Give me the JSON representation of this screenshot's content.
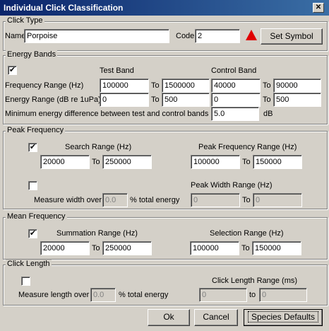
{
  "window": {
    "title": "Individual Click Classification",
    "close_label": "✕"
  },
  "click_type": {
    "legend": "Click Type",
    "name_label": "Name",
    "name_value": "Porpoise",
    "code_label": "Code",
    "code_value": "2",
    "symbol_icon": "red-triangle-icon",
    "symbol_color": "#e00000",
    "set_symbol_label": "Set Symbol"
  },
  "energy_bands": {
    "legend": "Energy Bands",
    "checked": true,
    "check_mark": "✔",
    "test_band_label": "Test Band",
    "control_band_label": "Control Band",
    "freq_label": "Frequency Range (Hz)",
    "freq_test_min": "100000",
    "freq_test_max": "1500000",
    "freq_ctrl_min": "40000",
    "freq_ctrl_max": "90000",
    "energy_label": "Energy Range (dB re 1uPa)",
    "energy_test_min": "0",
    "energy_test_max": "500",
    "energy_ctrl_min": "0",
    "energy_ctrl_max": "500",
    "to_label": "To",
    "min_diff_label": "Minimum energy difference between test and control bands",
    "min_diff_value": "5.0",
    "db_label": "dB"
  },
  "peak_frequency": {
    "legend": "Peak Frequency",
    "search_checked": true,
    "check_mark": "✔",
    "search_label": "Search Range (Hz)",
    "search_min": "20000",
    "search_max": "250000",
    "peak_range_label": "Peak Frequency Range (Hz)",
    "peak_min": "100000",
    "peak_max": "150000",
    "to_label": "To",
    "width_checked": false,
    "measure_width_label": "Measure width over",
    "width_pct": "0.0",
    "pct_total_label": "% total energy",
    "peak_width_label": "Peak Width Range (Hz)",
    "width_min": "0",
    "width_max": "0"
  },
  "mean_frequency": {
    "legend": "Mean Frequency",
    "checked": true,
    "check_mark": "✔",
    "summation_label": "Summation Range (Hz)",
    "sum_min": "20000",
    "sum_max": "250000",
    "selection_label": "Selection Range (Hz)",
    "sel_min": "100000",
    "sel_max": "150000",
    "to_label": "To"
  },
  "click_length": {
    "legend": "Click Length",
    "checked": false,
    "measure_length_label": "Measure length over",
    "length_pct": "0.0",
    "pct_total_label": "% total energy",
    "range_label": "Click Length Range (ms)",
    "len_min": "0",
    "len_max": "0",
    "to_label": "to"
  },
  "buttons": {
    "ok": "Ok",
    "cancel": "Cancel",
    "species_defaults": "Species Defaults"
  }
}
